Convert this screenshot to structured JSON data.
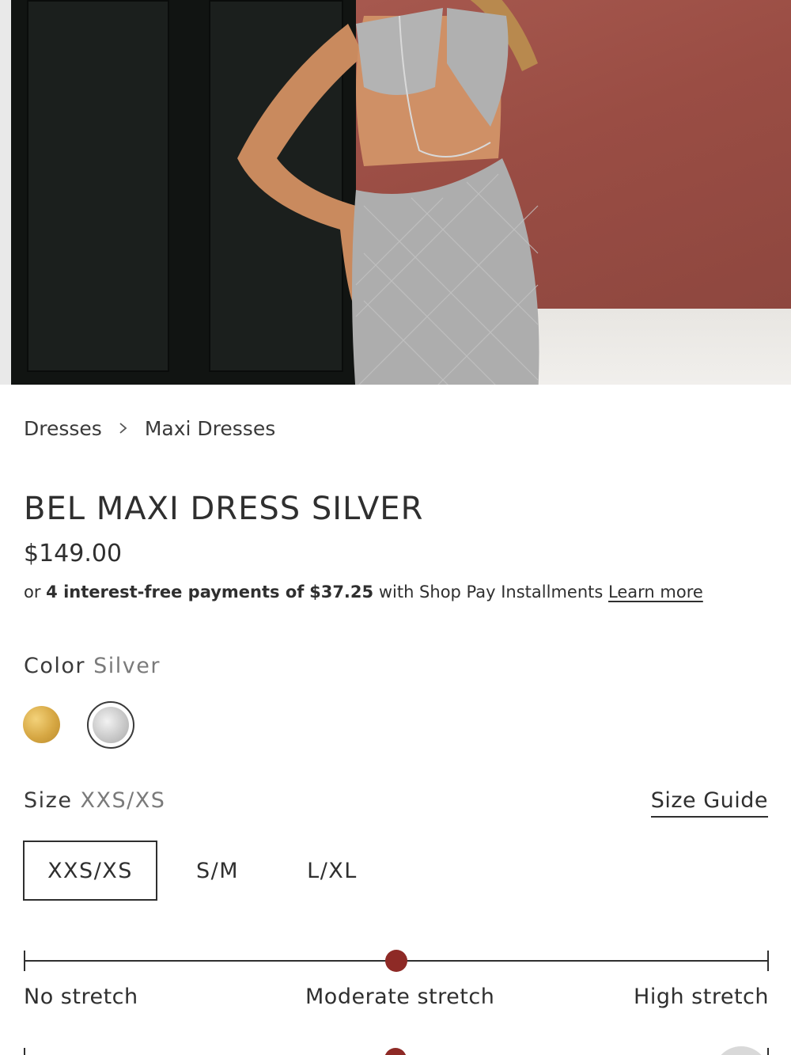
{
  "product_image": {
    "alt": "Model wearing silver knit halter maxi dress"
  },
  "breadcrumb": {
    "items": [
      "Dresses",
      "Maxi Dresses"
    ]
  },
  "product": {
    "title": "BEL MAXI DRESS SILVER",
    "price": "$149.00",
    "installments": {
      "prefix": "or",
      "bold_text": "4 interest-free payments of",
      "amount": "$37.25",
      "suffix": "with Shop Pay Installments",
      "link": "Learn more"
    }
  },
  "color": {
    "label": "Color",
    "selected": "Silver",
    "swatches": [
      {
        "name": "Gold",
        "hex": "#d6a743"
      },
      {
        "name": "Silver",
        "hex": "#c9c9c9"
      }
    ]
  },
  "size": {
    "label": "Size",
    "selected": "XXS/XS",
    "guide_link": "Size Guide",
    "options": [
      "XXS/XS",
      "S/M",
      "L/XL"
    ]
  },
  "stretch": {
    "labels": [
      "No stretch",
      "Moderate stretch",
      "High stretch"
    ],
    "level_fraction": 0.5,
    "accent": "#8e2a26"
  }
}
